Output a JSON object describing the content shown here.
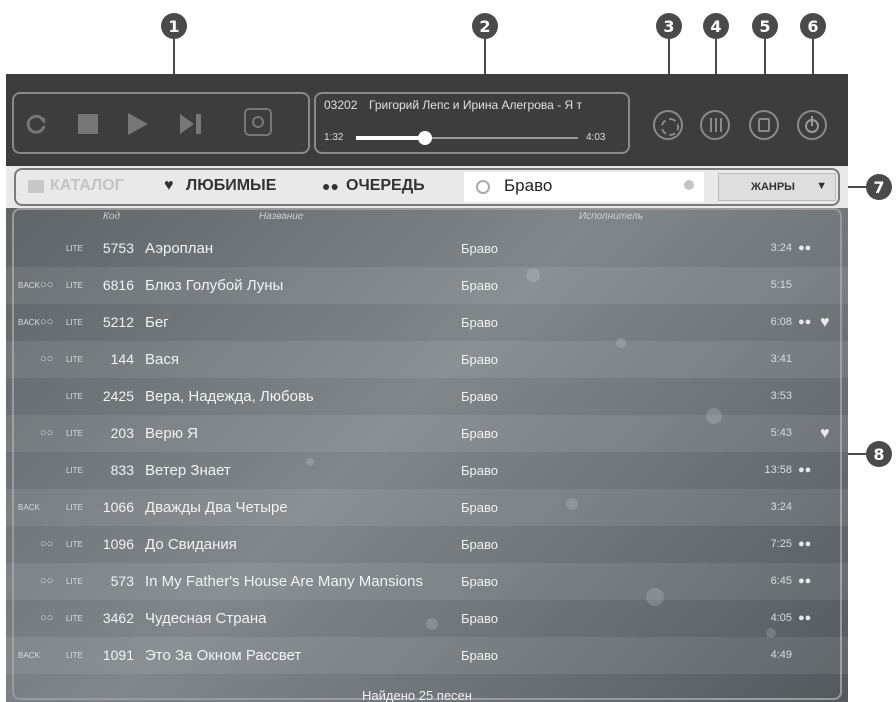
{
  "callouts": [
    "1",
    "2",
    "3",
    "4",
    "5",
    "6",
    "7",
    "8"
  ],
  "player": {
    "icons": [
      "refresh-icon",
      "stop-icon",
      "play-icon",
      "next-icon",
      "record-icon"
    ],
    "track_code": "03202",
    "track_title": "Григорий Лепс и Ирина Алегрова - Я т",
    "elapsed": "1:32",
    "duration": "4:03",
    "progress": 0.31
  },
  "nav": {
    "catalog": "КАТАЛОГ",
    "favorites": "ЛЮБИМЫЕ",
    "queue": "ОЧЕРЕДЬ",
    "search_value": "Браво",
    "genres": "ЖАНРЫ"
  },
  "table": {
    "col_code": "Код",
    "col_title": "Название",
    "col_artist": "Исполнитель",
    "rows": [
      {
        "back": false,
        "duet": false,
        "code": "5753",
        "title": "Аэроплан",
        "artist": "Браво",
        "time": "3:24",
        "queue": true,
        "fav": false
      },
      {
        "back": true,
        "duet": true,
        "code": "6816",
        "title": "Блюз Голубой Луны",
        "artist": "Браво",
        "time": "5:15",
        "queue": false,
        "fav": false
      },
      {
        "back": true,
        "duet": true,
        "code": "5212",
        "title": "Бег",
        "artist": "Браво",
        "time": "6:08",
        "queue": true,
        "fav": true
      },
      {
        "back": false,
        "duet": true,
        "code": "144",
        "title": "Вася",
        "artist": "Браво",
        "time": "3:41",
        "queue": false,
        "fav": false
      },
      {
        "back": false,
        "duet": false,
        "code": "2425",
        "title": "Вера, Надежда, Любовь",
        "artist": "Браво",
        "time": "3:53",
        "queue": false,
        "fav": false
      },
      {
        "back": false,
        "duet": true,
        "code": "203",
        "title": "Верю Я",
        "artist": "Браво",
        "time": "5:43",
        "queue": false,
        "fav": true
      },
      {
        "back": false,
        "duet": false,
        "code": "833",
        "title": "Ветер Знает",
        "artist": "Браво",
        "time": "13:58",
        "queue": true,
        "fav": false
      },
      {
        "back": true,
        "duet": false,
        "code": "1066",
        "title": "Дважды Два Четыре",
        "artist": "Браво",
        "time": "3:24",
        "queue": false,
        "fav": false
      },
      {
        "back": false,
        "duet": true,
        "code": "1096",
        "title": "До Свидания",
        "artist": "Браво",
        "time": "7:25",
        "queue": true,
        "fav": false
      },
      {
        "back": false,
        "duet": true,
        "code": "573",
        "title": "In My Father's House Are Many Mansions",
        "artist": "Браво",
        "time": "6:45",
        "queue": true,
        "fav": false
      },
      {
        "back": false,
        "duet": true,
        "code": "3462",
        "title": "Чудесная Страна",
        "artist": "Браво",
        "time": "4:05",
        "queue": true,
        "fav": false
      },
      {
        "back": true,
        "duet": false,
        "code": "1091",
        "title": "Это За Окном Рассвет",
        "artist": "Браво",
        "time": "4:49",
        "queue": false,
        "fav": false
      }
    ],
    "found": "Найдено 25 песен",
    "badge_lite": "LITE",
    "badge_back": "BACK"
  }
}
